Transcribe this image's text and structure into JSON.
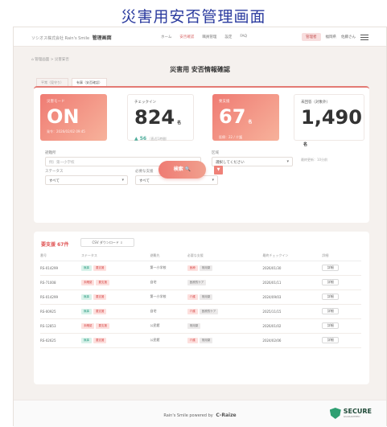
{
  "caption": "災害用安否管理画面",
  "brand": {
    "prefix": "ソシオス株式会社 Rain's Smile",
    "title": "管理画面"
  },
  "nav": [
    "ホーム",
    "安否確認",
    "職員管理",
    "設定",
    "FAQ"
  ],
  "nav_active_index": 1,
  "user_nav": {
    "role": "管理者",
    "org": "福岡県",
    "user": "佐藤さん"
  },
  "breadcrumb": "⌂ 管理画面 > 災害安否",
  "page_title": "災害用 安否情報確認",
  "tabs": [
    "平常（見守り）",
    "有事（安否確認）"
  ],
  "tabs_active_index": 1,
  "kpis": [
    {
      "label": "災害モード",
      "value": "ON",
      "unit": "",
      "sub": "発令：2026/02/02 09:45"
    },
    {
      "label": "チェックイン",
      "value": "824",
      "unit": "名",
      "delta": "▲ 56",
      "sub": "（直近1時間）"
    },
    {
      "label": "要支援",
      "value": "67",
      "unit": "名",
      "sub": "医療：22 / 介護"
    },
    {
      "label": "未回答（対象外）",
      "value": "1,490",
      "unit": "名",
      "sub": "最終更新：10分前"
    }
  ],
  "filters": {
    "place_label": "避難所",
    "place_placeholder": "例）第一小学校",
    "area_label": "区域",
    "area_value": "選択してください",
    "status_label": "ステータス",
    "status_value": "すべて",
    "support_label": "必要な支援",
    "support_value": "すべて"
  },
  "search_button": "検索 🔍",
  "filter_icon": "▼",
  "results": {
    "title": "要支援 67件",
    "csv": "CSV ダウンロード ⇩",
    "columns": [
      "番号",
      "ステータス",
      "避難先",
      "必要な支援",
      "最終チェックイン",
      "詳細"
    ],
    "rows": [
      {
        "id": "RS-014299",
        "status": [
          "無事",
          "要支援"
        ],
        "shelter": "第一小学校",
        "support": [
          "医療",
          "常用薬"
        ],
        "time": "2026/01/30",
        "detail": "詳細"
      },
      {
        "id": "RS-71008",
        "status": [
          "未確認",
          "要支援"
        ],
        "shelter": "自宅",
        "support": [
          "医療的ケア"
        ],
        "time": "2026/01/11",
        "detail": "詳細"
      },
      {
        "id": "RS-014299",
        "status": [
          "無事",
          "要支援"
        ],
        "shelter": "第一小学校",
        "support": [
          "介護",
          "常用薬"
        ],
        "time": "2024/09/03",
        "detail": "詳細"
      },
      {
        "id": "RS-00925",
        "status": [
          "無事",
          "要支援"
        ],
        "shelter": "自宅",
        "support": [
          "介護",
          "医療的ケア"
        ],
        "time": "2025/11/15",
        "detail": "詳細"
      },
      {
        "id": "RS-12853",
        "status": [
          "未確認",
          "要支援"
        ],
        "shelter": "公民館",
        "support": [
          "常用薬"
        ],
        "time": "2026/01/02",
        "detail": "詳細"
      },
      {
        "id": "RS-02625",
        "status": [
          "無事",
          "要支援"
        ],
        "shelter": "公民館",
        "support": [
          "介護",
          "常用薬"
        ],
        "time": "2024/02/06",
        "detail": "詳細"
      }
    ]
  },
  "footer": {
    "text": "Rain's Smile powered by",
    "brand": "C-Raize",
    "secure": "SECURE",
    "secure_sub": "GUARANTEED"
  }
}
